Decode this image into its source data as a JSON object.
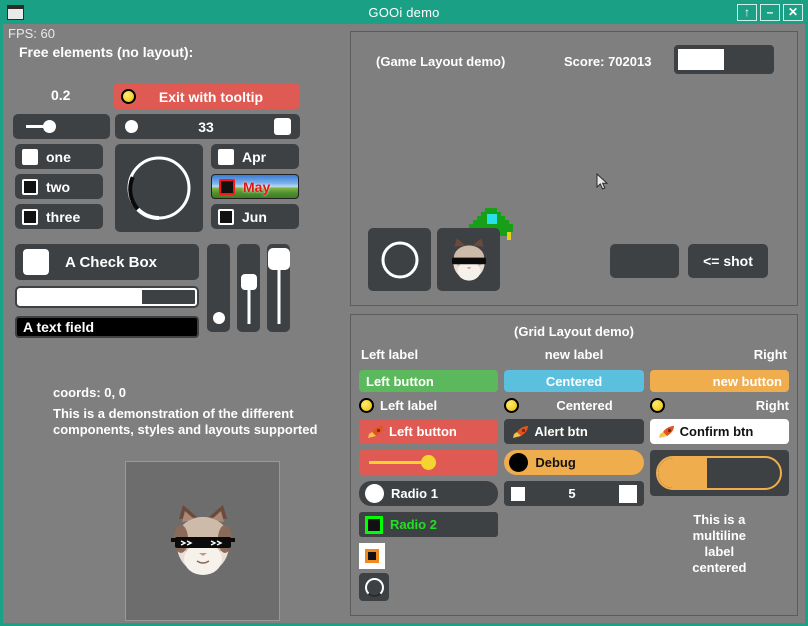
{
  "window": {
    "title": "GOOi demo",
    "icon": "window-icon",
    "controls": [
      {
        "name": "maximize-button",
        "glyph": "↑"
      },
      {
        "name": "minimize-button",
        "glyph": "–"
      },
      {
        "name": "close-button",
        "glyph": "✕"
      }
    ]
  },
  "theme": {
    "titlebar": "#1aa185",
    "body_bg": "#7f7f7f",
    "widget_dark": "#3d4143",
    "accent_red": "#df5a52",
    "accent_green": "#5cb85c",
    "accent_blue": "#5bc0de",
    "accent_orange": "#f0ad4e",
    "yellow": "#f5d430",
    "green_text": "#21e021"
  },
  "left": {
    "fps": "FPS: 60",
    "section_label": "Free elements (no layout):",
    "value_label": "0.2",
    "exit_button": "Exit with tooltip",
    "slider_value": 33,
    "spinner_value": "33",
    "checkbuttons": [
      {
        "label": "one",
        "checked": true
      },
      {
        "label": "two",
        "checked": false
      },
      {
        "label": "three",
        "checked": false
      }
    ],
    "monthbuttons": [
      {
        "label": "Apr",
        "checked": true,
        "style": "plain"
      },
      {
        "label": "May",
        "checked": false,
        "style": "wallpaper"
      },
      {
        "label": "Jun",
        "checked": false,
        "style": "plain"
      }
    ],
    "check_box_label": "A Check Box",
    "progress_percent": 70,
    "text_field_value": "A text field",
    "vsliders": [
      {
        "name": "vslider-1",
        "percent": 8,
        "handle": "small"
      },
      {
        "name": "vslider-2",
        "percent": 48,
        "handle": "medium"
      },
      {
        "name": "vslider-3",
        "percent": 88,
        "handle": "large"
      }
    ],
    "coords": "coords: 0, 0",
    "description": "This is a demonstration of the different components, styles and layouts supported",
    "image_alt": "grumpy-cat-sunglasses"
  },
  "game": {
    "title": "(Game Layout demo)",
    "score": "Score: 702013",
    "bar_percent": 50,
    "slot1": "circle-ring",
    "slot2": "cat-sprite",
    "sprite": "space-invader",
    "empty_button": "",
    "shot_button": "<= shot"
  },
  "grid": {
    "title": "(Grid Layout demo)",
    "labels_row": [
      "Left label",
      "new label",
      "Right"
    ],
    "buttons_row": [
      {
        "label": "Left button",
        "color": "#5cb85c",
        "align": "left"
      },
      {
        "label": "Centered",
        "color": "#5bc0de",
        "align": "center"
      },
      {
        "label": "new button",
        "color": "#f0ad4e",
        "align": "right"
      }
    ],
    "bullet_row": [
      {
        "label": "Left label",
        "align": "left"
      },
      {
        "label": "Centered",
        "align": "center"
      },
      {
        "label": "Right",
        "align": "right"
      }
    ],
    "rocket_row": [
      {
        "label": "Left button",
        "bg": "#df5a52",
        "fg": "#ffffff",
        "align": "left"
      },
      {
        "label": "Alert btn",
        "bg": "#3d4143",
        "fg": "#ffffff",
        "align": "center"
      },
      {
        "label": "Confirm btn",
        "bg": "#ffffff",
        "fg": "#111111",
        "align": "center"
      }
    ],
    "slider_percent": 78,
    "debug_toggle": "Debug",
    "stepper_value": "5",
    "toggle_percent": 40,
    "radio1": "Radio 1",
    "radio2": "Radio 2",
    "multiline_label": "This is a\nmultiline\nlabel\ncentered",
    "square_button": "square-swatch",
    "circle_button": "circle-swatch"
  }
}
